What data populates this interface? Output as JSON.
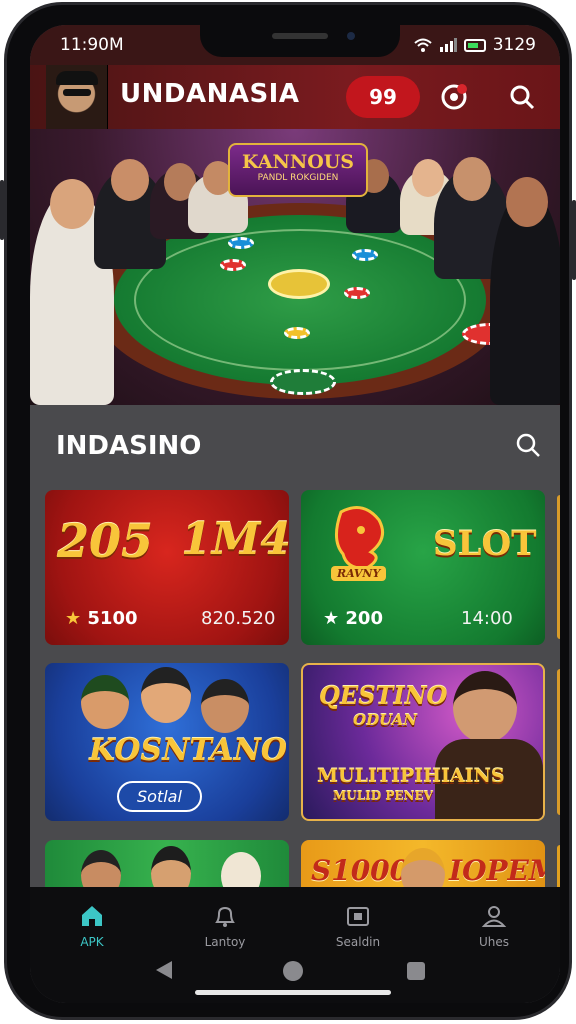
{
  "status_bar": {
    "time": "11:90M",
    "battery": "3129"
  },
  "header": {
    "title": "UNDANASIA",
    "badge": "99"
  },
  "hero": {
    "title": "KANNOUS",
    "subtitle": "PANDL ROKGIDEN"
  },
  "section": {
    "title": "INDASINO"
  },
  "games": [
    {
      "left_text": "205",
      "right_text": "1M4",
      "rating": "5100",
      "value": "820.520"
    },
    {
      "left_text": "RAVNY",
      "right_text": "SLOT",
      "rating": "200",
      "value": "14:00"
    },
    {
      "title": "KOSNTANO",
      "button": "Sotlal"
    },
    {
      "title": "QESTINO",
      "subtitle": "ODUAN",
      "line1": "MULITIPIHIAINS",
      "line2": "MULID PENEV"
    },
    {
      "title": ""
    },
    {
      "left_text": "S1000",
      "right_text": "IOPEM"
    }
  ],
  "bottom_nav": [
    {
      "label": "APK",
      "icon": "home-icon",
      "active": true
    },
    {
      "label": "Lantoy",
      "icon": "bell-icon",
      "active": false
    },
    {
      "label": "Sealdin",
      "icon": "wallet-icon",
      "active": false
    },
    {
      "label": "Uhes",
      "icon": "user-icon",
      "active": false
    }
  ],
  "colors": {
    "header": "#7a1b1f",
    "accent": "#c2161d",
    "active_nav": "#3cc6c6",
    "gold": "#f8c53a"
  }
}
